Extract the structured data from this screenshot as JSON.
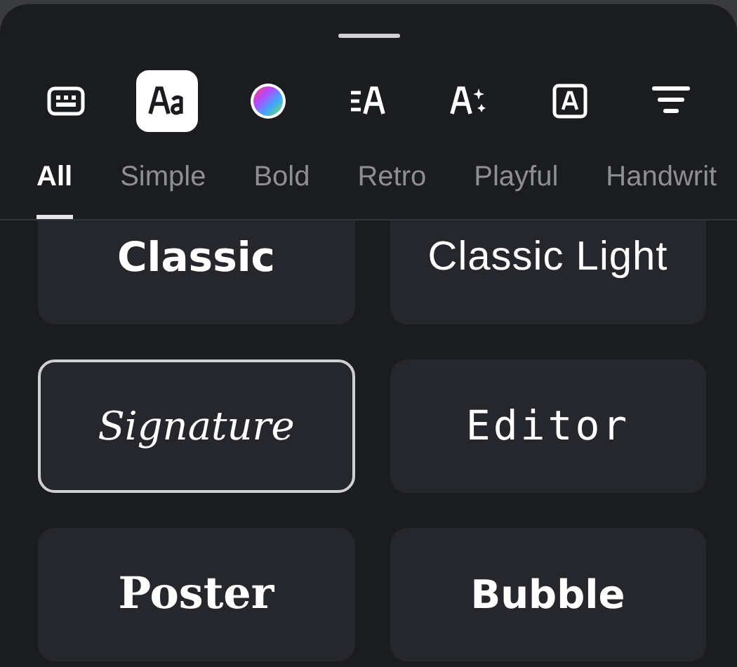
{
  "toolbar": [
    {
      "selected": false
    },
    {
      "selected": true
    },
    {
      "selected": false
    },
    {
      "selected": false
    },
    {
      "selected": false
    },
    {
      "selected": false
    },
    {
      "selected": false
    }
  ],
  "tabs": [
    {
      "label": "All",
      "selected": true
    },
    {
      "label": "Simple",
      "selected": false
    },
    {
      "label": "Bold",
      "selected": false
    },
    {
      "label": "Retro",
      "selected": false
    },
    {
      "label": "Playful",
      "selected": false
    },
    {
      "label": "Handwrit",
      "selected": false
    }
  ],
  "fonts": [
    {
      "name": "Classic",
      "kind": "bold",
      "selected": false
    },
    {
      "name": "Classic Light",
      "kind": "light",
      "selected": false
    },
    {
      "name": "Signature",
      "kind": "script",
      "selected": true
    },
    {
      "name": "Editor",
      "kind": "mono",
      "selected": false
    },
    {
      "name": "Poster",
      "kind": "serif",
      "selected": false
    },
    {
      "name": "Bubble",
      "kind": "rounded",
      "selected": false
    }
  ]
}
